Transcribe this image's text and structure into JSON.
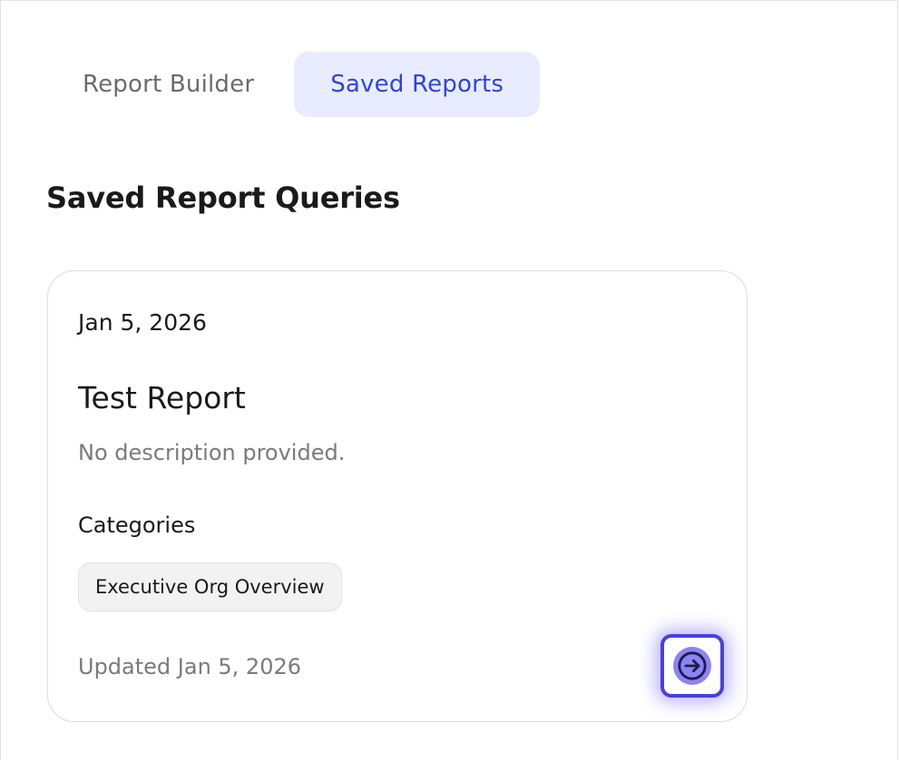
{
  "tabs": [
    {
      "label": "Report Builder",
      "active": false
    },
    {
      "label": "Saved Reports",
      "active": true
    }
  ],
  "section": {
    "title": "Saved Report Queries"
  },
  "card": {
    "date": "Jan 5, 2026",
    "title": "Test Report",
    "description": "No description provided.",
    "categories_label": "Categories",
    "categories": [
      "Executive Org Overview"
    ],
    "updated": "Updated Jan 5, 2026",
    "open_icon": "arrow-right-circle-icon"
  },
  "colors": {
    "active_tab_bg": "#e9ecff",
    "active_tab_text": "#2e45d6",
    "focus_ring": "#4a3fe0",
    "button_fill": "#8b84f2"
  }
}
